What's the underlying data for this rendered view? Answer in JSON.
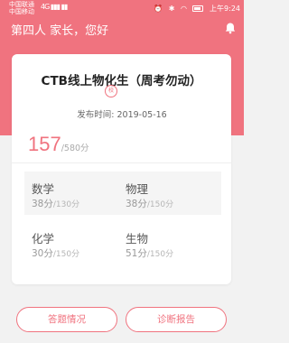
{
  "statusbar": {
    "carrier_1": "中国联通",
    "carrier_2": "中国移动",
    "signal_1": "4G",
    "time": "上午9:24"
  },
  "header": {
    "greeting": "第四人 家长，您好"
  },
  "exam": {
    "title": "CTB线上物化生（周考勿动）",
    "badge": "校",
    "publish_label": "发布时间:",
    "publish_date": "2019-05-16",
    "total_score": "157",
    "total_full": "/580分"
  },
  "subjects": [
    {
      "name": "数学",
      "score": "38分",
      "full": "/130分"
    },
    {
      "name": "物理",
      "score": "38分",
      "full": "/150分"
    },
    {
      "name": "化学",
      "score": "30分",
      "full": "/150分"
    },
    {
      "name": "生物",
      "score": "51分",
      "full": "/150分"
    }
  ],
  "actions": {
    "answers_label": "答题情况",
    "report_label": "诊断报告"
  },
  "colors": {
    "accent": "#f0737f",
    "background": "#f2f2f2"
  }
}
